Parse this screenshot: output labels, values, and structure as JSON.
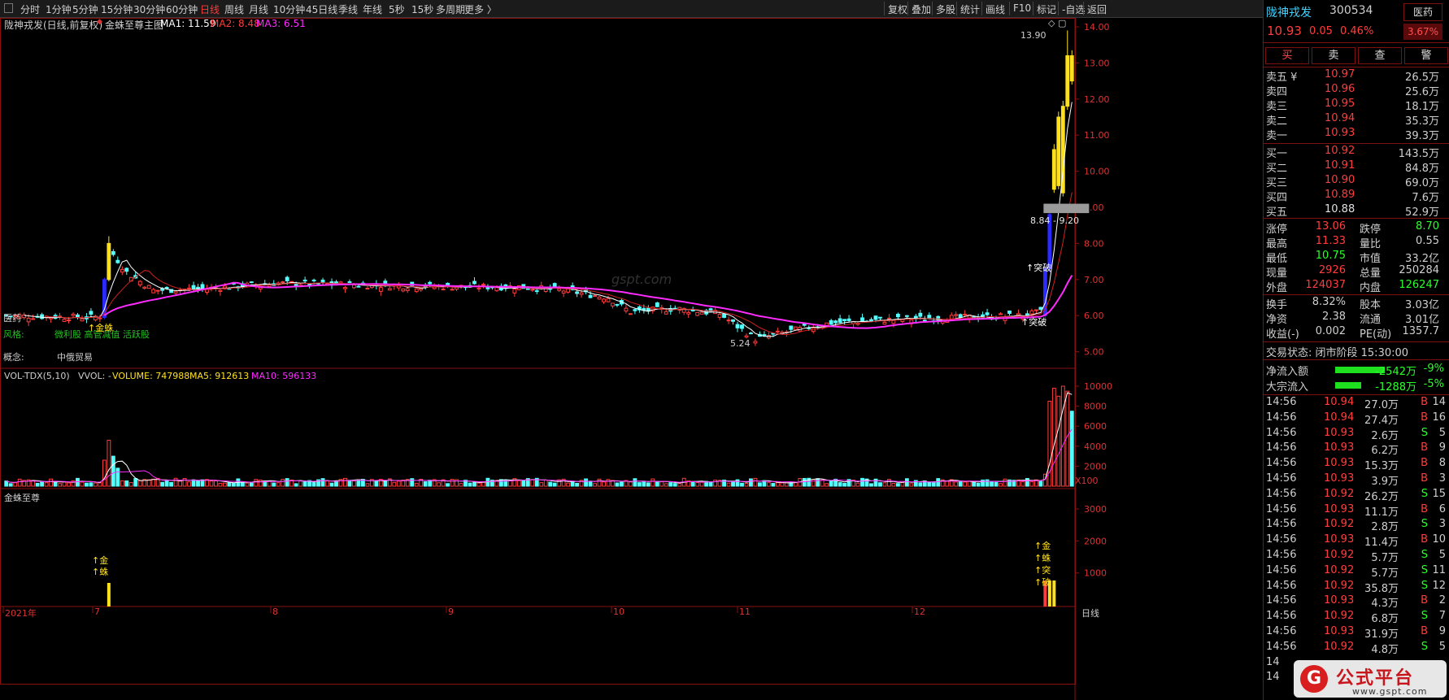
{
  "toolbar": {
    "timeframes": [
      "分时",
      "1分钟",
      "5分钟",
      "15分钟",
      "30分钟",
      "60分钟",
      "日线",
      "周线",
      "月线",
      "10分钟",
      "45日线",
      "季线",
      "年线",
      "5秒",
      "15秒",
      "多周期",
      "更多 〉"
    ],
    "active_index": 6,
    "tools": [
      "复权",
      "叠加",
      "多股",
      "统计",
      "画线",
      "F10",
      "标记",
      "-自选",
      "返回"
    ]
  },
  "main_panel": {
    "title": "陇神戎发(日线,前复权)",
    "indicator_name": "金蛛至尊主图",
    "ma1": "MA1: 11.59",
    "ma2": "MA2: 8.48",
    "ma3": "MA3: 6.51",
    "price_axis": [
      "14.00",
      "13.00",
      "12.00",
      "11.00",
      "10.00",
      "9.00",
      "8.00",
      "7.00",
      "6.00",
      "5.00"
    ],
    "high_label": "13.90",
    "low_label": "5.24",
    "zone_label": "8.84 - 9.20",
    "tag_yiyao": "医药",
    "style_label": "风格:",
    "style_values": "微利股 高管减值 活跃股",
    "concept_label": "概念:",
    "concept_values": "中俄贸易",
    "signal_jinzhu": "↑金蛛",
    "signal_tupo1": "↑突破",
    "signal_tupo2": "↑突破",
    "watermark_text": "gspt.com"
  },
  "volume_panel": {
    "title": "VOL-TDX(5,10)",
    "vvol": "VVOL: -",
    "volume": "VOLUME: 747988",
    "ma5": "MA5: 912613",
    "ma10": "MA10: 596133",
    "axis": [
      "10000",
      "8000",
      "6000",
      "4000",
      "2000"
    ],
    "unit": "X100"
  },
  "signal_panel": {
    "title": "金蛛至尊",
    "axis": [
      "3000",
      "2000",
      "1000"
    ],
    "marker_left": [
      "↑金",
      "↑蛛"
    ],
    "marker_right": [
      "↑金",
      "↑蛛",
      "↑突",
      "↑破"
    ]
  },
  "date_axis": {
    "labels": [
      "2021年",
      "7",
      "8",
      "9",
      "10",
      "11",
      "12"
    ],
    "period": "日线"
  },
  "quote": {
    "name": "陇神戎发",
    "code": "300534",
    "sector": "医药",
    "price": "10.93",
    "change": "0.05",
    "pct": "0.46%",
    "sector_pct": "3.67%",
    "buttons": [
      "买",
      "卖",
      "查",
      "警"
    ],
    "asks": [
      {
        "label": "卖五 ¥",
        "price": "10.97",
        "vol": "26.5万"
      },
      {
        "label": "卖四",
        "price": "10.96",
        "vol": "25.6万"
      },
      {
        "label": "卖三",
        "price": "10.95",
        "vol": "18.1万"
      },
      {
        "label": "卖二",
        "price": "10.94",
        "vol": "35.3万"
      },
      {
        "label": "卖一",
        "price": "10.93",
        "vol": "39.3万"
      }
    ],
    "bids": [
      {
        "label": "买一",
        "price": "10.92",
        "vol": "143.5万"
      },
      {
        "label": "买二",
        "price": "10.91",
        "vol": "84.8万"
      },
      {
        "label": "买三",
        "price": "10.90",
        "vol": "69.0万"
      },
      {
        "label": "买四",
        "price": "10.89",
        "vol": "7.6万"
      },
      {
        "label": "买五",
        "price": "10.88",
        "vol": "52.9万"
      }
    ],
    "stats": [
      {
        "l1": "涨停",
        "v1": "13.06",
        "l2": "跌停",
        "v2": "8.70"
      },
      {
        "l1": "最高",
        "v1": "11.33",
        "l2": "量比",
        "v2": "0.55"
      },
      {
        "l1": "最低",
        "v1": "10.75",
        "l2": "市值",
        "v2": "33.2亿"
      },
      {
        "l1": "现量",
        "v1": "2926",
        "l2": "总量",
        "v2": "250284"
      },
      {
        "l1": "外盘",
        "v1": "124037",
        "l2": "内盘",
        "v2": "126247"
      }
    ],
    "stats2": [
      {
        "l1": "换手",
        "v1": "8.32%",
        "l2": "股本",
        "v2": "3.03亿"
      },
      {
        "l1": "净资",
        "v1": "2.38",
        "l2": "流通",
        "v2": "3.01亿"
      },
      {
        "l1": "收益(-)",
        "v1": "0.002",
        "l2": "PE(动)",
        "v2": "1357.7"
      }
    ],
    "trade_status": "交易状态: 闭市阶段 15:30:00",
    "flows": [
      {
        "label": "净流入额",
        "value": "-2542万",
        "pct": "-9%",
        "bar": 0.85
      },
      {
        "label": "大宗流入",
        "value": "-1288万",
        "pct": "-5%",
        "bar": 0.45
      }
    ],
    "ticks": [
      {
        "t": "14:56",
        "p": "10.94",
        "v": "27.0万",
        "d": "B",
        "n": "14"
      },
      {
        "t": "14:56",
        "p": "10.94",
        "v": "27.4万",
        "d": "B",
        "n": "16"
      },
      {
        "t": "14:56",
        "p": "10.93",
        "v": "2.6万",
        "d": "S",
        "n": "5"
      },
      {
        "t": "14:56",
        "p": "10.93",
        "v": "6.2万",
        "d": "B",
        "n": "9"
      },
      {
        "t": "14:56",
        "p": "10.93",
        "v": "15.3万",
        "d": "B",
        "n": "8"
      },
      {
        "t": "14:56",
        "p": "10.93",
        "v": "3.9万",
        "d": "B",
        "n": "3"
      },
      {
        "t": "14:56",
        "p": "10.92",
        "v": "26.2万",
        "d": "S",
        "n": "15"
      },
      {
        "t": "14:56",
        "p": "10.93",
        "v": "11.1万",
        "d": "B",
        "n": "6"
      },
      {
        "t": "14:56",
        "p": "10.92",
        "v": "2.8万",
        "d": "S",
        "n": "3"
      },
      {
        "t": "14:56",
        "p": "10.93",
        "v": "11.4万",
        "d": "B",
        "n": "10"
      },
      {
        "t": "14:56",
        "p": "10.92",
        "v": "5.7万",
        "d": "S",
        "n": "5"
      },
      {
        "t": "14:56",
        "p": "10.92",
        "v": "5.7万",
        "d": "S",
        "n": "11"
      },
      {
        "t": "14:56",
        "p": "10.92",
        "v": "35.8万",
        "d": "S",
        "n": "12"
      },
      {
        "t": "14:56",
        "p": "10.93",
        "v": "4.3万",
        "d": "B",
        "n": "2"
      },
      {
        "t": "14:56",
        "p": "10.92",
        "v": "6.8万",
        "d": "S",
        "n": "7"
      },
      {
        "t": "14:56",
        "p": "10.93",
        "v": "31.9万",
        "d": "B",
        "n": "9"
      },
      {
        "t": "14:56",
        "p": "10.92",
        "v": "4.8万",
        "d": "S",
        "n": "5"
      },
      {
        "t": "14",
        "p": "",
        "v": "",
        "d": "",
        "n": ""
      },
      {
        "t": "14",
        "p": "",
        "v": "",
        "d": "",
        "n": ""
      }
    ]
  },
  "watermark": {
    "glyph": "G",
    "title": "公式平台",
    "url": "www.gspt.com"
  },
  "colors": {
    "up": "#ff3d3d",
    "down": "#54ffff",
    "ma3": "#ff2bff",
    "ma1": "#ffffff",
    "yellow": "#ffe01f",
    "blue": "#2b2bff",
    "frame": "#8a1010"
  }
}
